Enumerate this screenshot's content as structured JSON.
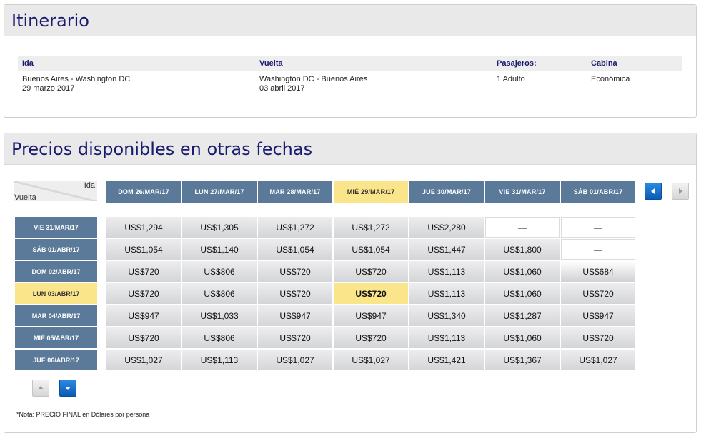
{
  "itinerary": {
    "title": "Itinerario",
    "headers": {
      "ida": "Ida",
      "vuelta": "Vuelta",
      "pasajeros": "Pasajeros:",
      "cabina": "Cabina"
    },
    "ida_route": "Buenos Aires - Washington DC",
    "ida_date": "29 marzo 2017",
    "vuelta_route": "Washington DC - Buenos Aires",
    "vuelta_date": "03 abril 2017",
    "pasajeros": "1 Adulto",
    "cabina": "Económica"
  },
  "prices": {
    "title": "Precios disponibles en otras fechas",
    "corner_ida": "Ida",
    "corner_vuelta": "Vuelta",
    "columns": [
      "DOM 26/MAR/17",
      "LUN 27/MAR/17",
      "MAR 28/MAR/17",
      "MIÉ 29/MAR/17",
      "JUE 30/MAR/17",
      "VIE 31/MAR/17",
      "SÁB 01/ABR/17"
    ],
    "rows": [
      {
        "label": "VIE 31/MAR/17",
        "cells": [
          "US$1,294",
          "US$1,305",
          "US$1,272",
          "US$1,272",
          "US$2,280",
          "—",
          "—"
        ]
      },
      {
        "label": "SÁB 01/ABR/17",
        "cells": [
          "US$1,054",
          "US$1,140",
          "US$1,054",
          "US$1,054",
          "US$1,447",
          "US$1,800",
          "—"
        ]
      },
      {
        "label": "DOM 02/ABR/17",
        "cells": [
          "US$720",
          "US$806",
          "US$720",
          "US$720",
          "US$1,113",
          "US$1,060",
          "US$684"
        ]
      },
      {
        "label": "LUN 03/ABR/17",
        "cells": [
          "US$720",
          "US$806",
          "US$720",
          "US$720",
          "US$1,113",
          "US$1,060",
          "US$720"
        ]
      },
      {
        "label": "MAR 04/ABR/17",
        "cells": [
          "US$947",
          "US$1,033",
          "US$947",
          "US$947",
          "US$1,340",
          "US$1,287",
          "US$947"
        ]
      },
      {
        "label": "MIÉ 05/ABR/17",
        "cells": [
          "US$720",
          "US$806",
          "US$720",
          "US$720",
          "US$1,113",
          "US$1,060",
          "US$720"
        ]
      },
      {
        "label": "JUE 06/ABR/17",
        "cells": [
          "US$1,027",
          "US$1,113",
          "US$1,027",
          "US$1,027",
          "US$1,421",
          "US$1,367",
          "US$1,027"
        ]
      }
    ],
    "note": "*Nota: PRECIO FINAL en Dólares por persona"
  },
  "colors": {
    "header_blue": "#5b7a9a",
    "selected_yellow": "#fbe58b",
    "title_navy": "#1a1a6e",
    "button_blue": "#1a73d0"
  },
  "icons": {
    "prev_columns": "arrow-left-icon",
    "next_columns": "arrow-right-icon",
    "prev_rows": "arrow-up-icon",
    "next_rows": "arrow-down-icon"
  }
}
